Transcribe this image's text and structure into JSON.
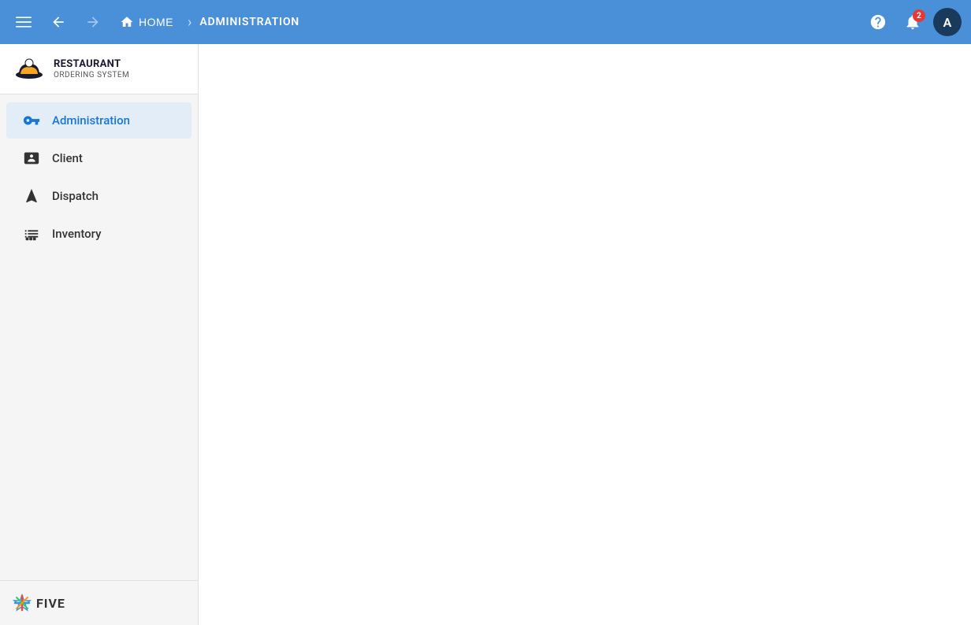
{
  "topbar": {
    "home_label": "HOME",
    "breadcrumb": "ADMINISTRATION",
    "notification_count": "2",
    "avatar_letter": "A",
    "chevron": "›"
  },
  "sidebar": {
    "logo": {
      "title": "RESTAURANT",
      "subtitle": "ORDERING SYSTEM"
    },
    "nav_items": [
      {
        "id": "administration",
        "label": "Administration",
        "active": true
      },
      {
        "id": "client",
        "label": "Client",
        "active": false
      },
      {
        "id": "dispatch",
        "label": "Dispatch",
        "active": false
      },
      {
        "id": "inventory",
        "label": "Inventory",
        "active": false
      }
    ],
    "footer": {
      "brand": "FIVE"
    }
  }
}
